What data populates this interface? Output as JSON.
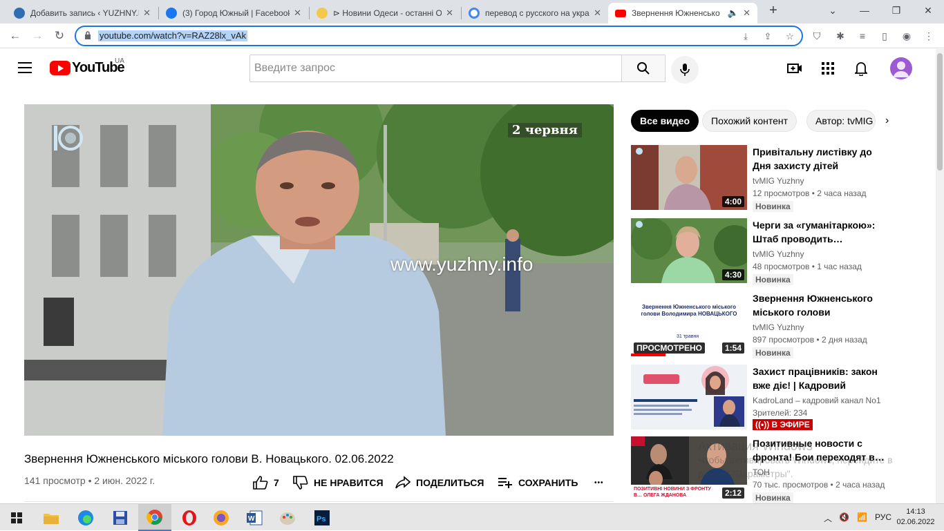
{
  "browser": {
    "tabs": [
      {
        "label": "Добавить запись ‹ YUZHNY.INFO",
        "active": false
      },
      {
        "label": "(3) Город Южный | Facebook",
        "active": false
      },
      {
        "label": "⊳ Новини Одеси - останні О",
        "active": false
      },
      {
        "label": "перевод с русского на укра",
        "active": false
      },
      {
        "label": "Звернення Южненсько",
        "active": true
      }
    ],
    "new_tab": "+",
    "url": "youtube.com/watch?v=RAZ28lx_vAk"
  },
  "youtube": {
    "logo_text": "YouTube",
    "country_code": "UA",
    "search_placeholder": "Введите запрос"
  },
  "video": {
    "overlay_date": "2 червня",
    "overlay_watermark": "www.yuzhny.info",
    "title": "Звернення Южненського міського голови В. Новацького. 02.06.2022",
    "meta": "141 просмотр • 2 июн. 2022 г.",
    "likes": "7",
    "dislike_label": "НЕ НРАВИТСЯ",
    "share_label": "ПОДЕЛИТЬСЯ",
    "save_label": "СОХРАНИТЬ",
    "more": "•••"
  },
  "chips": [
    "Все видео",
    "Похожий контент",
    "Автор: tvMIG"
  ],
  "recommendations": [
    {
      "title": "Привітальну листівку до Дня захисту дітей виготовили на…",
      "channel": "tvMIG Yuzhny",
      "stats": "12 просмотров • 2 часа назад",
      "badge": "Новинка",
      "duration": "4:00"
    },
    {
      "title": "Черги за «гуманітаркою»: Штаб проводить…",
      "channel": "tvMIG Yuzhny",
      "stats": "48 просмотров • 1 час назад",
      "badge": "Новинка",
      "duration": "4:30"
    },
    {
      "title": "Звернення Южненського міського голови Володимир…",
      "channel": "tvMIG Yuzhny",
      "stats": "897 просмотров • 2 дня назад",
      "badge": "Новинка",
      "duration": "1:54",
      "watched": "ПРОСМОТРЕНО",
      "progress": 0.3,
      "thumb_text": "Звернення Южненського міського голови Володимира НОВАЦЬКОГО",
      "thumb_date": "31 травня"
    },
    {
      "title": "Захист працівників: закон вже діє! | Кадровий марафо…",
      "channel": "KadroLand – кадровий канал No1",
      "stats": "Зрителей: 234",
      "live": "В ЭФИРЕ"
    },
    {
      "title": "Позитивные новости с фронта! Бои переходят в…",
      "channel": "ТОН",
      "stats": "70 тыс. просмотров • 2 часа назад",
      "badge": "Новинка",
      "duration": "2:12",
      "thumb_text": "ПОЗИТИВНІ НОВИНИ З ФРОНТУ В… ОЛЕГА ЖДАНОВА"
    }
  ],
  "watermark": {
    "line1": "Активация Windows",
    "line2": "Чтобы активировать Windows, перейдите в",
    "line3": "раздел \"Параметры\"."
  },
  "taskbar": {
    "lang": "РУС",
    "time": "14:13",
    "date": "02.06.2022"
  }
}
